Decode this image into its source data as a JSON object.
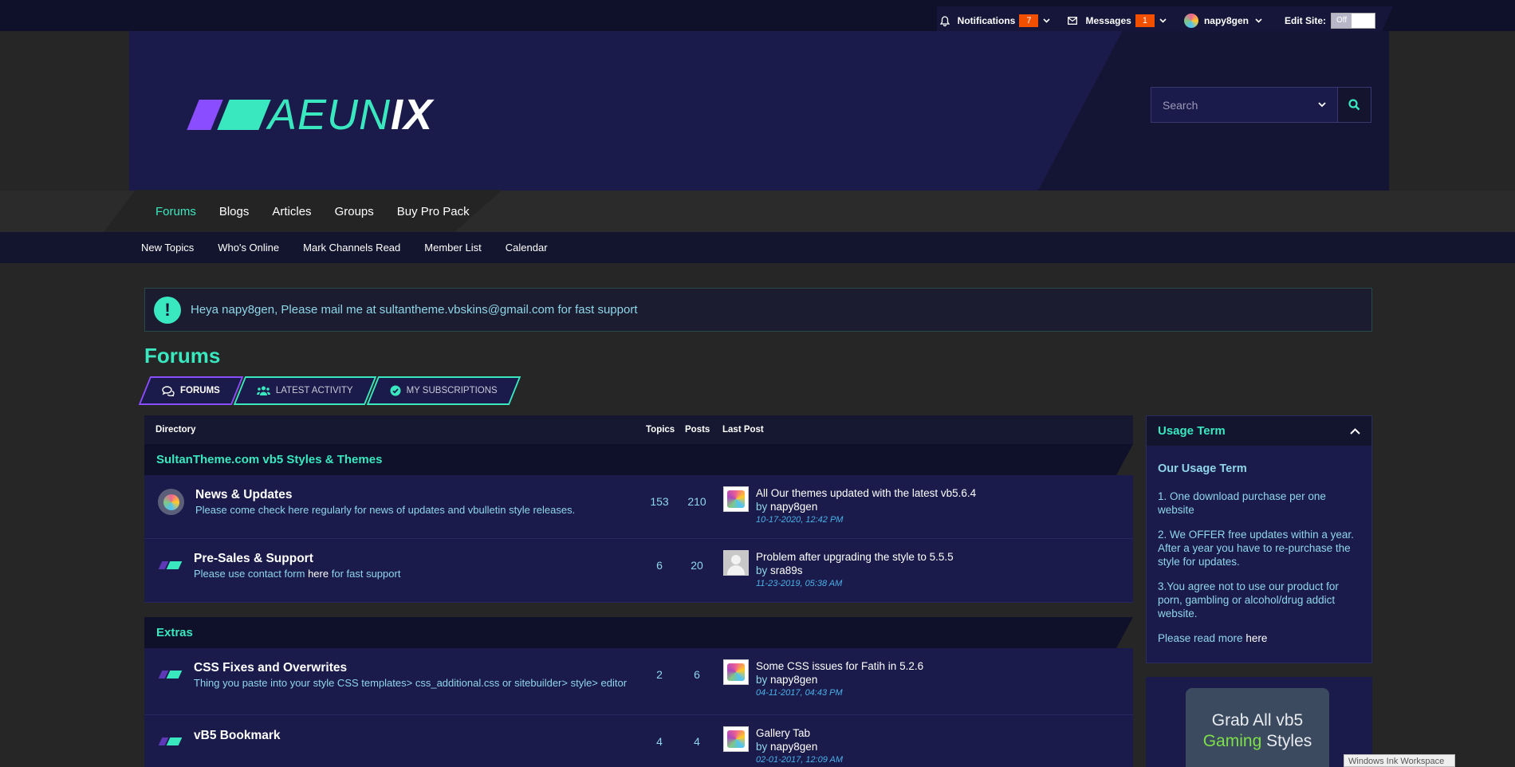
{
  "topbar": {
    "notifications_label": "Notifications",
    "notifications_count": "7",
    "messages_label": "Messages",
    "messages_count": "1",
    "username": "napy8gen",
    "edit_site_label": "Edit Site:",
    "edit_site_toggle": "Off"
  },
  "logo": {
    "part1": "AEUN",
    "part2": "IX"
  },
  "search": {
    "placeholder": "Search"
  },
  "main_nav": [
    "Forums",
    "Blogs",
    "Articles",
    "Groups",
    "Buy Pro Pack"
  ],
  "sub_nav": [
    "New Topics",
    "Who's Online",
    "Mark Channels Read",
    "Member List",
    "Calendar"
  ],
  "notice": {
    "text": "Heya napy8gen, Please mail me at sultantheme.vbskins@gmail.com for fast support"
  },
  "page_title": "Forums",
  "tabs": [
    "FORUMS",
    "LATEST ACTIVITY",
    "MY SUBSCRIPTIONS"
  ],
  "table": {
    "headers": {
      "directory": "Directory",
      "topics": "Topics",
      "posts": "Posts",
      "last_post": "Last Post"
    },
    "sections": [
      {
        "title": "SultanTheme.com vb5 Styles & Themes",
        "forums": [
          {
            "title": "News & Updates",
            "desc": "Please come check here regularly for news of updates and vbulletin style releases.",
            "topics": "153",
            "posts": "210",
            "last_title": "All Our themes updated with the latest vb5.6.4",
            "by_prefix": "by ",
            "last_user": "napy8gen",
            "last_date": "10-17-2020, 12:42 PM"
          },
          {
            "title": "Pre-Sales & Support",
            "desc_a": "Please use contact form ",
            "desc_link": "here",
            "desc_b": " for fast support",
            "topics": "6",
            "posts": "20",
            "last_title": "Problem after upgrading the style to 5.5.5",
            "by_prefix": "by ",
            "last_user": "sra89s",
            "last_date": "11-23-2019, 05:38 AM"
          }
        ]
      },
      {
        "title": "Extras",
        "forums": [
          {
            "title": "CSS Fixes and Overwrites",
            "desc": "Thing you paste into your style CSS templates> css_additional.css or sitebuilder> style> editor",
            "topics": "2",
            "posts": "6",
            "last_title": "Some CSS issues for Fatih in 5.2.6",
            "by_prefix": "by ",
            "last_user": "napy8gen",
            "last_date": "04-11-2017, 04:43 PM"
          },
          {
            "title": "vB5 Bookmark",
            "topics": "4",
            "posts": "4",
            "last_title": "Gallery Tab",
            "by_prefix": "by ",
            "last_user": "napy8gen",
            "last_date": "02-01-2017, 12:09 AM"
          }
        ]
      }
    ]
  },
  "sidebar": {
    "title": "Usage Term",
    "heading": "Our Usage Term",
    "items": [
      "1. One download purchase per one website",
      "2. We OFFER free updates within a year. After a year you have to re-purchase the style for updates.",
      "3.You agree not to use our product for porn, gambling or alcohol/drug addict website."
    ],
    "read_more": "Please read more ",
    "read_more_link": "here",
    "ad_line1": "Grab All vb5",
    "ad_line2a": "Gaming",
    "ad_line2b": " Styles"
  },
  "os_badge": "Windows Ink Workspace",
  "colors": {
    "accent": "#3ae8c0",
    "purple": "#8a4dff",
    "badge": "#f24f00",
    "panel": "#1b1b4b"
  }
}
